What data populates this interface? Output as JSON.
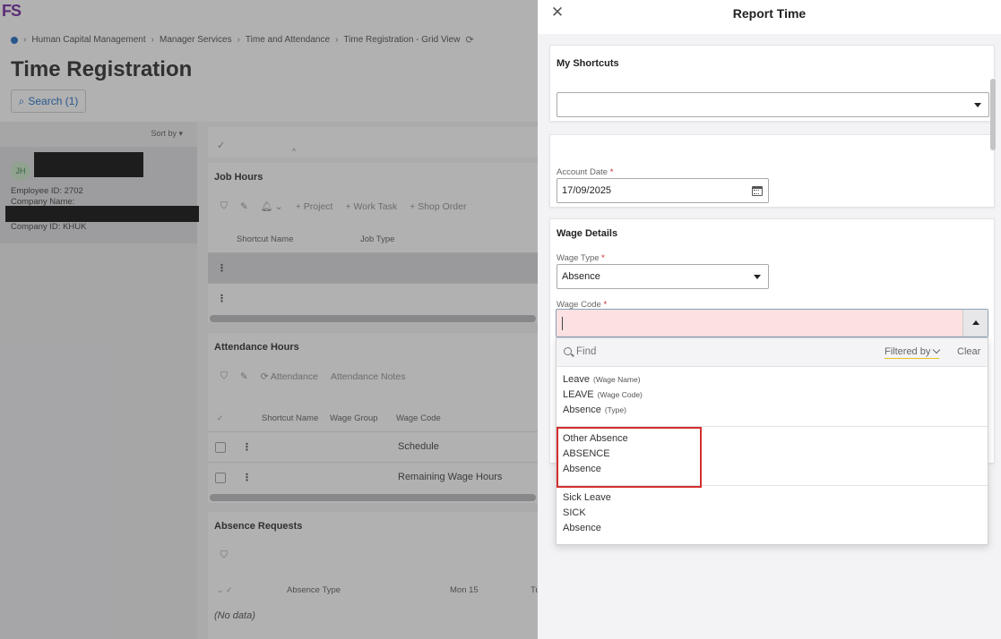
{
  "app": {
    "logo": "FS",
    "breadcrumb": [
      "Human Capital Management",
      "Manager Services",
      "Time and Attendance",
      "Time Registration - Grid View"
    ],
    "page_title": "Time Registration",
    "search_label": "Search (1)",
    "sort_label": "Sort by",
    "employee": {
      "initials": "JH",
      "employee_id_label": "Employee ID:",
      "employee_id": "2702",
      "company_name_label": "Company Name:",
      "company_id_label": "Company ID:",
      "company_id": "KHUK"
    },
    "job_hours": {
      "title": "Job Hours",
      "toolbar": [
        "+ Project",
        "+ Work Task",
        "+ Shop Order"
      ],
      "columns": [
        "Shortcut Name",
        "Job Type"
      ]
    },
    "attendance_hours": {
      "title": "Attendance Hours",
      "toolbar": [
        "Attendance",
        "Attendance Notes"
      ],
      "columns": [
        "Shortcut Name",
        "Wage Group",
        "Wage Code"
      ],
      "rows": [
        "Schedule",
        "Remaining Wage Hours"
      ]
    },
    "absence_requests": {
      "title": "Absence Requests",
      "columns": [
        "Absence Type",
        "Mon 15",
        "Tu"
      ],
      "empty_text": "(No data)"
    }
  },
  "panel": {
    "title": "Report Time",
    "shortcuts": {
      "title": "My Shortcuts",
      "value": ""
    },
    "account_date": {
      "label": "Account Date",
      "required_mark": "*",
      "value": "17/09/2025"
    },
    "wage_details": {
      "title": "Wage Details",
      "wage_type_label": "Wage Type",
      "wage_type_value": "Absence",
      "wage_code_label": "Wage Code",
      "required_mark": "*"
    },
    "dropdown": {
      "find_placeholder": "Find",
      "filtered_by": "Filtered by",
      "clear": "Clear",
      "header_item": {
        "name": "Leave",
        "name_hint": "(Wage Name)",
        "code": "LEAVE",
        "code_hint": "(Wage Code)",
        "type": "Absence",
        "type_hint": "(Type)"
      },
      "items": [
        {
          "name": "Other Absence",
          "code": "ABSENCE",
          "type": "Absence"
        },
        {
          "name": "Sick Leave",
          "code": "SICK",
          "type": "Absence"
        }
      ]
    }
  },
  "colors": {
    "accent": "#1565c0",
    "logo": "#6a1b9a",
    "invalid_field": "#fbe1e1",
    "highlight": "#d32f2f"
  }
}
